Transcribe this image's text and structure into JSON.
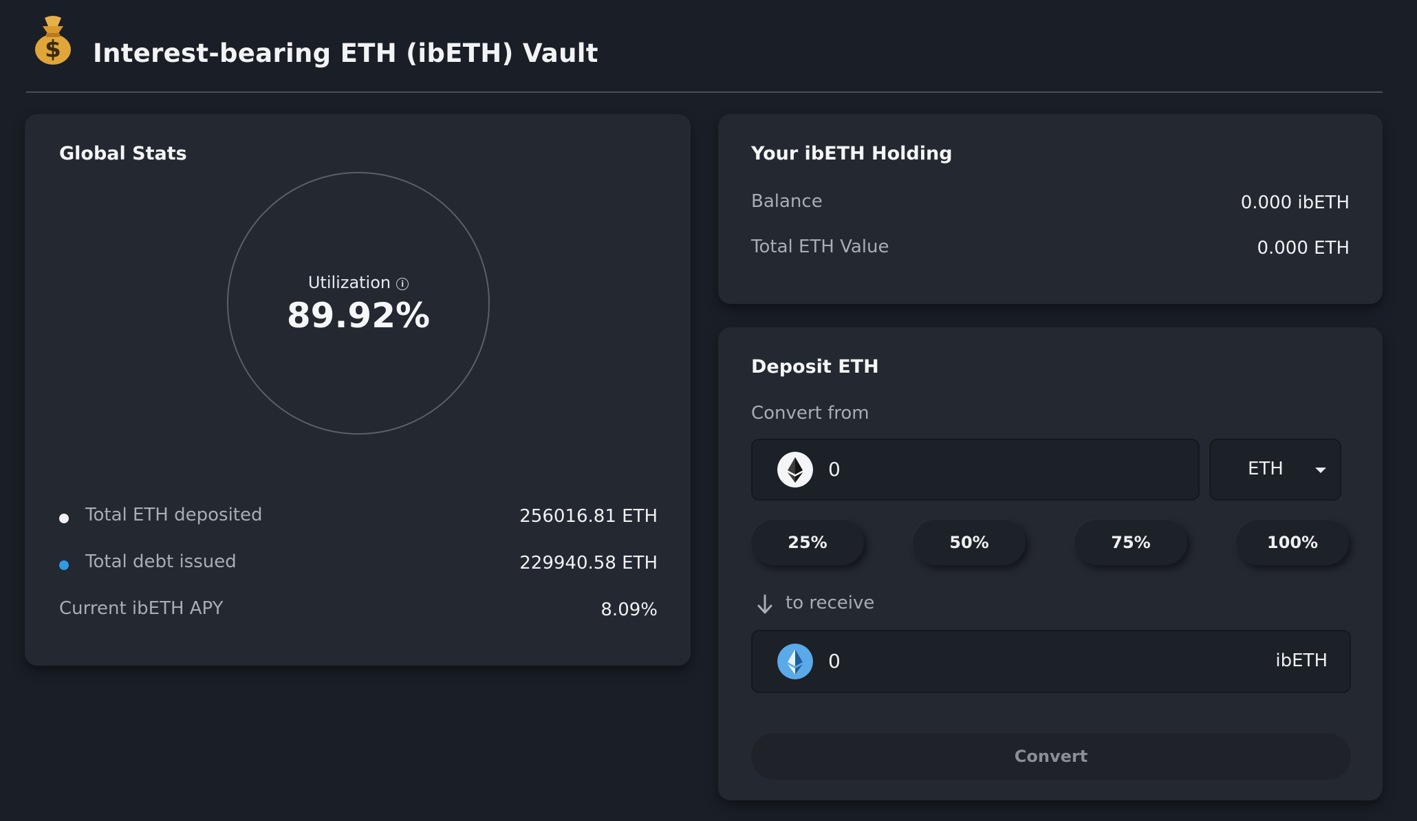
{
  "header": {
    "title": "Interest-bearing ETH (ibETH) Vault",
    "logo_icon": "money-bag-icon"
  },
  "global_stats": {
    "title": "Global Stats",
    "utilization_label": "Utilization",
    "utilization_value": "89.92%",
    "rows": [
      {
        "label": "Total ETH deposited",
        "value": "256016.81 ETH",
        "dot_color": "#f2f2f2"
      },
      {
        "label": "Total debt issued",
        "value": "229940.58 ETH",
        "dot_color": "#2f9ae5"
      },
      {
        "label": "Current ibETH APY",
        "value": "8.09%"
      }
    ]
  },
  "holding": {
    "title": "Your ibETH Holding",
    "balance_label": "Balance",
    "balance_value": "0.000 ibETH",
    "eth_value_label": "Total ETH Value",
    "eth_value": "0.000 ETH"
  },
  "deposit": {
    "title": "Deposit ETH",
    "convert_from_label": "Convert from",
    "from_amount": "0",
    "from_token": "ETH",
    "percent_buttons": [
      "25%",
      "50%",
      "75%",
      "100%"
    ],
    "receive_label": "to receive",
    "to_amount": "0",
    "to_token": "ibETH",
    "convert_button": "Convert"
  },
  "colors": {
    "background": "#1a1f27",
    "card": "#232831",
    "accent_blue": "#2f9ae5"
  }
}
